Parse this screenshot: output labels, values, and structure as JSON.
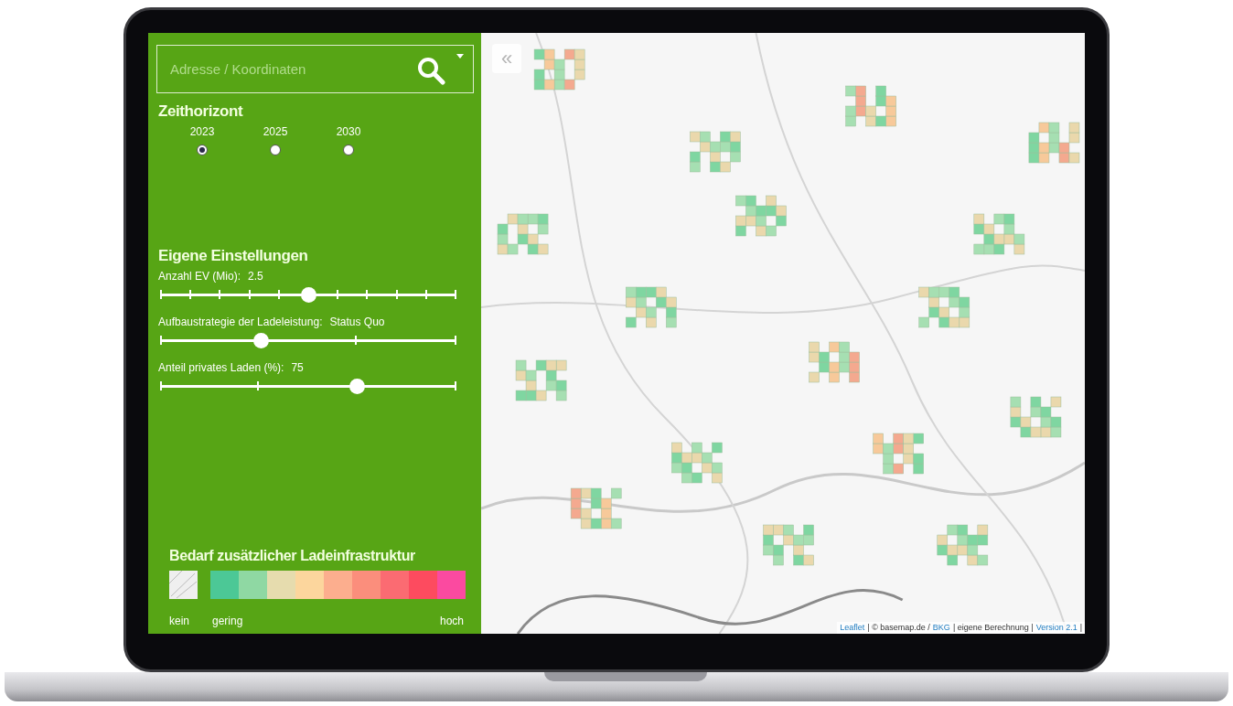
{
  "search": {
    "placeholder": "Adresse / Koordinaten"
  },
  "time_horizon": {
    "title": "Zeithorizont",
    "options": [
      {
        "label": "2023",
        "selected": true
      },
      {
        "label": "2025",
        "selected": false
      },
      {
        "label": "2030",
        "selected": false
      }
    ]
  },
  "settings": {
    "title": "Eigene Einstellungen",
    "sliders": [
      {
        "label": "Anzahl EV (Mio):",
        "reading": "2.5",
        "level": 0.5
      },
      {
        "label": "Aufbaustrategie der Ladeleistung:",
        "reading": "Status Quo",
        "level": 0.34
      },
      {
        "label": "Anteil privates Laden (%):",
        "reading": "75",
        "level": 0.665
      }
    ]
  },
  "legend": {
    "title": "Bedarf zusätzlicher Ladeinfrastruktur",
    "swatches": [
      {
        "color": "#4cc896"
      },
      {
        "color": "#8fd8a3"
      },
      {
        "color": "#e6dcae"
      },
      {
        "color": "#fcd69d"
      },
      {
        "color": "#fcae8e"
      },
      {
        "color": "#fb8e7c"
      },
      {
        "color": "#fb6b72"
      },
      {
        "color": "#fd4b5f"
      },
      {
        "color": "#fb4aa0"
      }
    ],
    "labels": [
      "kein",
      "gering",
      "hoch"
    ]
  },
  "map": {
    "collapse_button": "«",
    "attribution": [
      {
        "text": "Leaflet",
        "link": true
      },
      {
        "text": "| © basemap.de /",
        "link": false
      },
      {
        "text": "BKG",
        "link": true
      },
      {
        "text": "| eigene Berechnung |",
        "link": false
      },
      {
        "text": "Version 2.1",
        "link": true
      },
      {
        "text": "|",
        "link": false
      }
    ]
  }
}
